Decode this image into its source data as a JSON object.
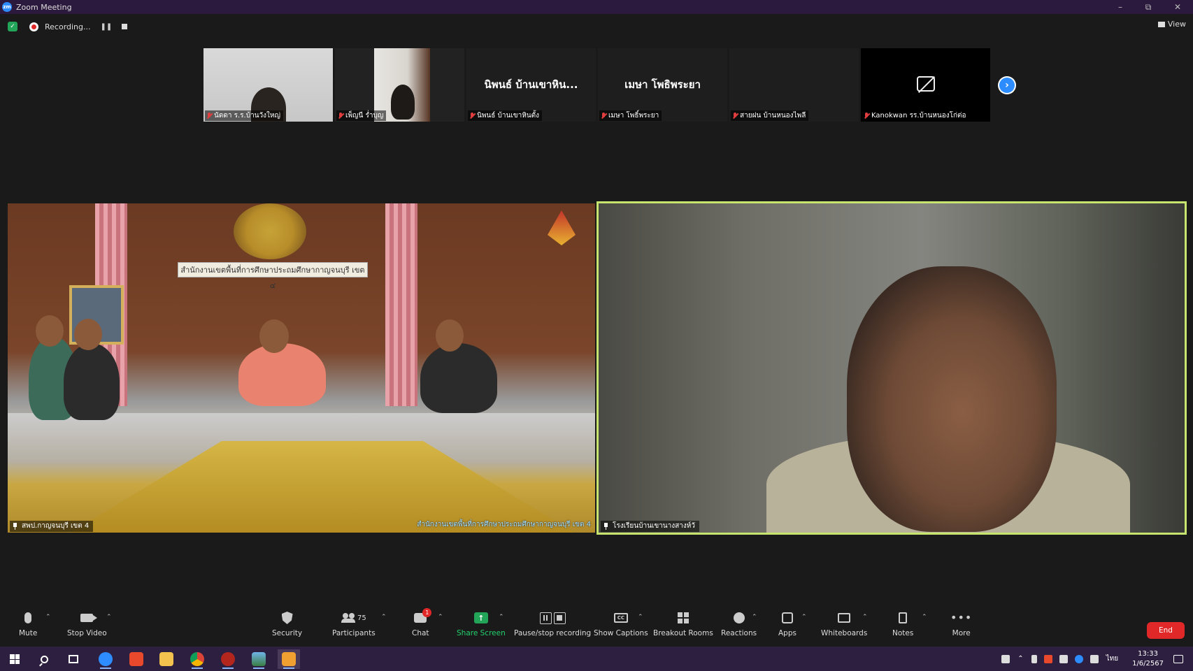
{
  "window": {
    "title": "Zoom Meeting",
    "app_icon": "zoom-icon"
  },
  "recording": {
    "status": "Recording..."
  },
  "view_button": "View",
  "gallery_strip": [
    {
      "label": "นัดดา ร.ร.บ้านวังใหญ่",
      "muted": true,
      "has_video": true
    },
    {
      "label": "เพ็ญนี ร่ำบุญ",
      "muted": true,
      "has_video": true
    },
    {
      "label": "นิพนธ์ บ้านเขาหินตั้ง",
      "big_name": "นิพนธ์ บ้านเขาหิน...",
      "muted": true,
      "has_video": false
    },
    {
      "label": "เมษา โพธิ์พระยา",
      "big_name": "เมษา โพธิพระยา",
      "muted": true,
      "has_video": false
    },
    {
      "label": "สายฝน บ้านหนองไพลี",
      "muted": true,
      "has_video": false
    },
    {
      "label": "Kanokwan รร.บ้านหนองโก่ต่อ",
      "muted": true,
      "has_video": false,
      "camera_off_icon": true
    }
  ],
  "main_videos": [
    {
      "name": "สพป.กาญจนบุรี เขต 4",
      "banner": "สำนักงานเขตพื้นที่การศึกษาประถมศึกษากาญจนบุรี เขต ๔",
      "overlay": "สำนักงานเขตพื้นที่การศึกษาประถมศึกษากาญจนบุรี เขต 4",
      "pinned": true
    },
    {
      "name": "โรงเรียนบ้านเขานางสางห์วั",
      "pinned": true,
      "active_speaker": true,
      "highlight_color": "#c6e46e"
    }
  ],
  "toolbar": {
    "mute": "Mute",
    "stop_video": "Stop Video",
    "security": "Security",
    "participants": "Participants",
    "participants_count": "75",
    "chat": "Chat",
    "chat_badge": "1",
    "share_screen": "Share Screen",
    "pause_stop_recording": "Pause/stop recording",
    "show_captions": "Show Captions",
    "breakout_rooms": "Breakout Rooms",
    "reactions": "Reactions",
    "apps": "Apps",
    "whiteboards": "Whiteboards",
    "notes": "Notes",
    "more": "More",
    "end": "End"
  },
  "taskbar": {
    "time": "13:33",
    "date": "1/6/2567",
    "lang": "ไทย"
  },
  "colors": {
    "end_button": "#e02828",
    "share_green": "#23a559",
    "active_speaker_border": "#c6e46e",
    "zoom_blue": "#2d8cff"
  }
}
